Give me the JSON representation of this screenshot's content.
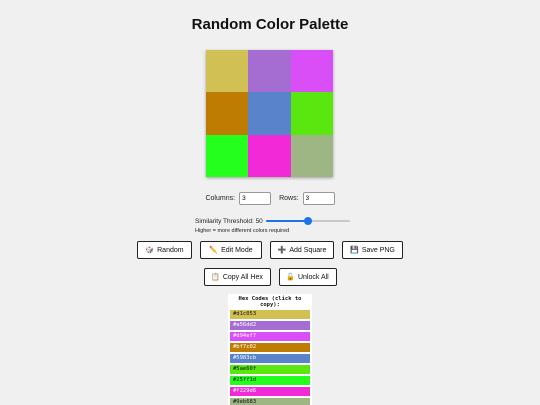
{
  "title": "Random Color Palette",
  "palette": {
    "columns": 3,
    "rows": 3,
    "colors": [
      "#d1c053",
      "#a56dd2",
      "#d94ef7",
      "#bf7c02",
      "#5983cb",
      "#5ae60f",
      "#25ff1d",
      "#f229d6",
      "#9eb683"
    ]
  },
  "controls": {
    "columns_label": "Columns:",
    "columns_value": "3",
    "rows_label": "Rows:",
    "rows_value": "3",
    "threshold_label": "Similarity Threshold: 50",
    "threshold_value": 50,
    "threshold_max": 100,
    "accent_color": "#1a73e8",
    "threshold_hint": "Higher = more different colors required"
  },
  "buttons": {
    "random": {
      "icon": "🎲",
      "label": "Random"
    },
    "edit_mode": {
      "icon": "✏️",
      "label": "Edit Mode"
    },
    "add_square": {
      "icon": "➕",
      "label": "Add Square"
    },
    "save_png": {
      "icon": "💾",
      "label": "Save PNG"
    },
    "copy_all_hex": {
      "icon": "📋",
      "label": "Copy All Hex"
    },
    "unlock_all": {
      "icon": "🔓",
      "label": "Unlock All"
    }
  },
  "hex_panel": {
    "title": "Hex Codes (click to copy):",
    "codes": [
      "#d1c053",
      "#a56dd2",
      "#d94ef7",
      "#bf7c02",
      "#5983cb",
      "#5ae60f",
      "#25ff1d",
      "#f229d6",
      "#9eb683"
    ]
  }
}
